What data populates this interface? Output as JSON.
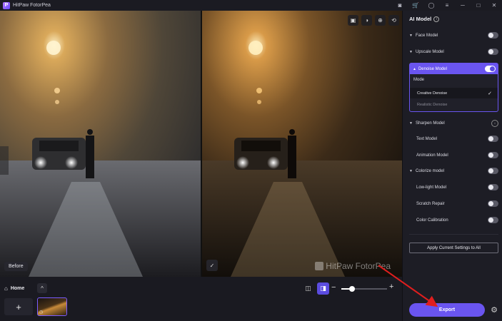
{
  "app": {
    "title": "HitPaw FotorPea",
    "logo": "P"
  },
  "titlebar": {
    "icons": [
      "discord-icon",
      "cart-icon",
      "account-icon",
      "menu-icon",
      "minimize-icon",
      "maximize-icon",
      "close-icon"
    ],
    "glyphs": [
      "◙",
      "🛒",
      "◯",
      "≡",
      "─",
      "□",
      "✕"
    ]
  },
  "canvas": {
    "before_label": "Before",
    "after_badge": "✓",
    "watermark": "HitPaw FotorPea",
    "tools": [
      "▣",
      "◑",
      "⊕",
      "⟲"
    ]
  },
  "bottom": {
    "home_label": "Home",
    "add_label": "+",
    "collapse_label": "^",
    "zoom_level": 0.24
  },
  "panel": {
    "title": "AI Model",
    "info": "i",
    "models": {
      "face": {
        "label": "Face Model",
        "on": false
      },
      "upscale": {
        "label": "Upscale Model",
        "on": false
      },
      "denoise": {
        "label": "Denoise Model",
        "on": true
      },
      "sharpen": {
        "label": "Sharpen Model"
      },
      "text": {
        "label": "Text Model",
        "on": false
      },
      "animation": {
        "label": "Animation Model",
        "on": false
      },
      "colorize": {
        "label": "Colorize model",
        "on": false
      },
      "lowlight": {
        "label": "Low-light Model",
        "on": false
      },
      "scratch": {
        "label": "Scratch Repair",
        "on": false
      },
      "color_cal": {
        "label": "Color Calibration",
        "on": false
      }
    },
    "mode_label": "Mode",
    "mode_options": [
      "Creative Denoise",
      "Realistic Denoise"
    ],
    "mode_selected": "Creative Denoise",
    "apply_label": "Apply Current Settings to All",
    "export_label": "Export"
  },
  "colors": {
    "accent": "#6a55f0",
    "panel_bg": "#1d1d25",
    "app_bg": "#16161d",
    "annotation_arrow": "#e01e1e"
  }
}
